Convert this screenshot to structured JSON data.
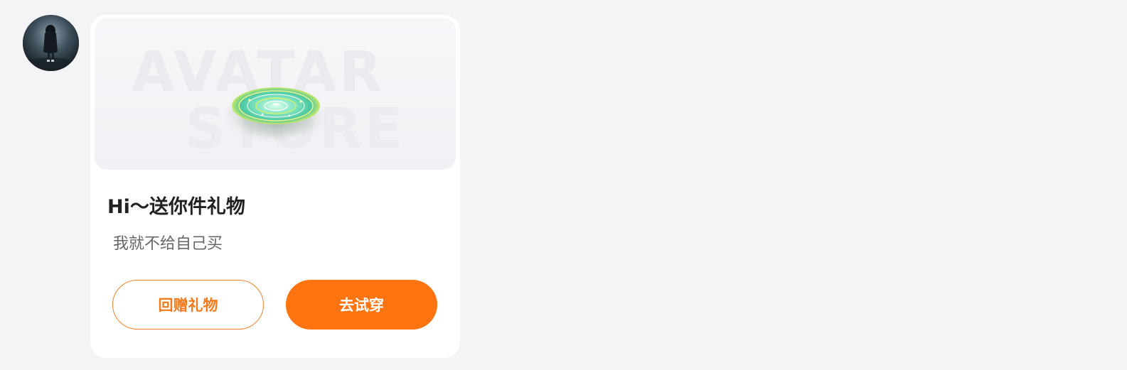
{
  "sender": {
    "avatar_icon": "girl-in-rain-avatar"
  },
  "gift_card": {
    "banner": {
      "watermark_line1": "AVATAR",
      "watermark_line2": "STORE",
      "item_icon": "holographic-disc-icon"
    },
    "title": "Hi～送你件礼物",
    "subtitle": "我就不给自己买",
    "buttons": {
      "return_gift_label": "回赠礼物",
      "try_on_label": "去试穿"
    }
  },
  "colors": {
    "page_bg": "#f4f4f6",
    "card_bg": "#ffffff",
    "accent_orange": "#ff7410",
    "title_text": "#222222",
    "subtitle_text": "#666666"
  }
}
